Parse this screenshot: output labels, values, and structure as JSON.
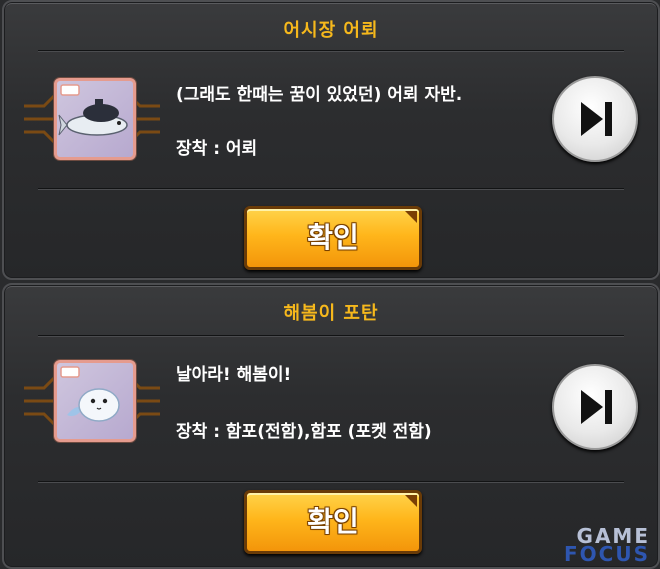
{
  "dialogs": [
    {
      "title": "어시장 어뢰",
      "description": "(그래도 한때는 꿈이 있었던) 어뢰 자반.",
      "equip": "장착 : 어뢰",
      "confirm_label": "확인",
      "skip_icon": "skip-forward-icon",
      "item_icon": "torpedo-fish-icon"
    },
    {
      "title": "해봄이 포탄",
      "description": "날아라! 해봄이!",
      "equip": "장착 : 함포(전함),함포 (포켓 전함)",
      "confirm_label": "확인",
      "skip_icon": "skip-forward-icon",
      "item_icon": "ghost-shell-icon"
    }
  ],
  "watermark": {
    "line1": "GAME",
    "line2": "FOCUS"
  },
  "colors": {
    "title": "#f6b81c",
    "button": "#ffb61b"
  }
}
